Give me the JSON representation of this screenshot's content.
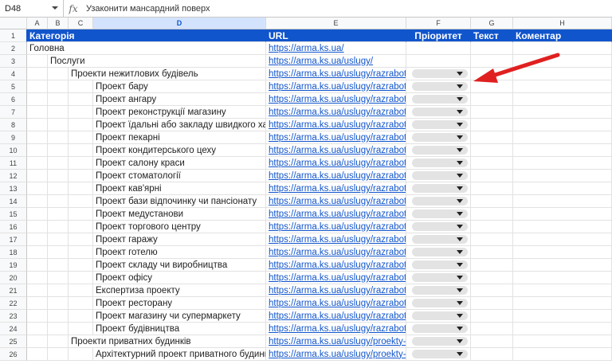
{
  "formula_bar": {
    "cell_ref": "D48",
    "fx": "fx",
    "content": "Узаконити мансардний поверх"
  },
  "columns": [
    "A",
    "B",
    "C",
    "D",
    "E",
    "F",
    "G",
    "H"
  ],
  "selected_column": "D",
  "header_row": {
    "row": "1",
    "category": "Категорія",
    "url": "URL",
    "priority": "Пріоритет",
    "text": "Текст",
    "comment": "Коментар"
  },
  "rows": [
    {
      "n": "2",
      "level": 0,
      "label": "Головна",
      "url": "https://arma.ks.ua/",
      "dropdown": false
    },
    {
      "n": "3",
      "level": 1,
      "label": "Послуги",
      "url": "https://arma.ks.ua/uslugy/",
      "dropdown": false
    },
    {
      "n": "4",
      "level": 2,
      "label": "Проекти нежитлових будівель",
      "url": "https://arma.ks.ua/uslugy/razrabotka-",
      "dropdown": true
    },
    {
      "n": "5",
      "level": 3,
      "label": "Проект бару",
      "url": "https://arma.ks.ua/uslugy/razrabotka-",
      "dropdown": true
    },
    {
      "n": "6",
      "level": 3,
      "label": "Проект ангару",
      "url": "https://arma.ks.ua/uslugy/razrabotka-",
      "dropdown": true
    },
    {
      "n": "7",
      "level": 3,
      "label": "Проект реконструкції магазину",
      "url": "https://arma.ks.ua/uslugy/razrabotka-",
      "dropdown": true
    },
    {
      "n": "8",
      "level": 3,
      "label": "Проект їдальні або закладу швидкого харчування",
      "url": "https://arma.ks.ua/uslugy/razrabotka-",
      "dropdown": true
    },
    {
      "n": "9",
      "level": 3,
      "label": "Проект пекарні",
      "url": "https://arma.ks.ua/uslugy/razrabotka-",
      "dropdown": true
    },
    {
      "n": "10",
      "level": 3,
      "label": "Проект кондитерського цеху",
      "url": "https://arma.ks.ua/uslugy/razrabotka-",
      "dropdown": true
    },
    {
      "n": "11",
      "level": 3,
      "label": "Проект салону краси",
      "url": "https://arma.ks.ua/uslugy/razrabotka-",
      "dropdown": true
    },
    {
      "n": "12",
      "level": 3,
      "label": "Проект стоматології",
      "url": "https://arma.ks.ua/uslugy/razrabotka-",
      "dropdown": true
    },
    {
      "n": "13",
      "level": 3,
      "label": "Проект кав'ярні",
      "url": "https://arma.ks.ua/uslugy/razrabotka-",
      "dropdown": true
    },
    {
      "n": "14",
      "level": 3,
      "label": "Проект бази відпочинку чи пансіонату",
      "url": "https://arma.ks.ua/uslugy/razrabotka-",
      "dropdown": true
    },
    {
      "n": "15",
      "level": 3,
      "label": "Проект медустанови",
      "url": "https://arma.ks.ua/uslugy/razrabotka-",
      "dropdown": true
    },
    {
      "n": "16",
      "level": 3,
      "label": "Проект торгового центру",
      "url": "https://arma.ks.ua/uslugy/razrabotka-",
      "dropdown": true
    },
    {
      "n": "17",
      "level": 3,
      "label": "Проект гаражу",
      "url": "https://arma.ks.ua/uslugy/razrabotka-",
      "dropdown": true
    },
    {
      "n": "18",
      "level": 3,
      "label": "Проект готелю",
      "url": "https://arma.ks.ua/uslugy/razrabotka-",
      "dropdown": true
    },
    {
      "n": "19",
      "level": 3,
      "label": "Проект складу чи виробництва",
      "url": "https://arma.ks.ua/uslugy/razrabotka-",
      "dropdown": true
    },
    {
      "n": "20",
      "level": 3,
      "label": "Проект офісу",
      "url": "https://arma.ks.ua/uslugy/razrabotka-",
      "dropdown": true
    },
    {
      "n": "21",
      "level": 3,
      "label": "Експертиза проекту",
      "url": "https://arma.ks.ua/uslugy/razrabotka-",
      "dropdown": true
    },
    {
      "n": "22",
      "level": 3,
      "label": "Проект ресторану",
      "url": "https://arma.ks.ua/uslugy/razrabotka-",
      "dropdown": true
    },
    {
      "n": "23",
      "level": 3,
      "label": "Проект магазину чи супермаркету",
      "url": "https://arma.ks.ua/uslugy/razrabotka-",
      "dropdown": true
    },
    {
      "n": "24",
      "level": 3,
      "label": "Проект будівництва",
      "url": "https://arma.ks.ua/uslugy/razrabotka-",
      "dropdown": true
    },
    {
      "n": "25",
      "level": 2,
      "label": "Проекти приватних будинків",
      "url": "https://arma.ks.ua/uslugy/proekty-cha",
      "dropdown": true
    },
    {
      "n": "26",
      "level": 3,
      "label": "Архітектурний проект приватного будинку",
      "url": "https://arma.ks.ua/uslugy/proekty-cha",
      "dropdown": true
    }
  ],
  "colors": {
    "header_bg": "#1155cc",
    "link": "#1155cc",
    "arrow": "#e02020",
    "chip": "#e3e3e3"
  },
  "annotation": "red-arrow-icon"
}
